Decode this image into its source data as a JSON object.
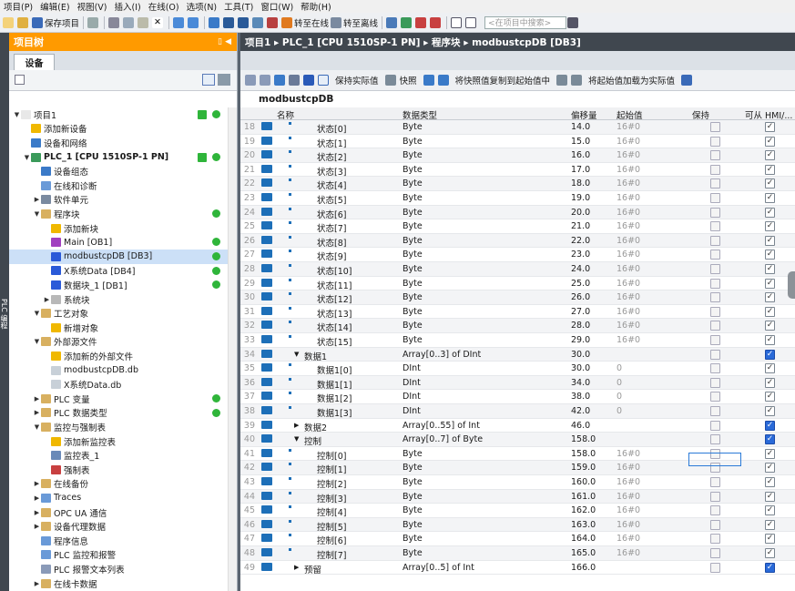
{
  "menu": [
    "项目(P)",
    "编辑(E)",
    "视图(V)",
    "插入(I)",
    "在线(O)",
    "选项(N)",
    "工具(T)",
    "窗口(W)",
    "帮助(H)"
  ],
  "toolbar": {
    "save_label": "保存项目",
    "online_label": "转至在线",
    "offline_label": "转至离线",
    "search_placeholder": "<在项目中搜索>"
  },
  "side_strip": "PLC 编程",
  "left_panel": {
    "title": "项目树",
    "tab": "设备"
  },
  "tree": [
    {
      "label": "项目1",
      "level": 0,
      "exp": "▼",
      "icon": "project-icon",
      "color": "#e8e8e8",
      "check": true,
      "dot": true
    },
    {
      "label": "添加新设备",
      "level": 1,
      "exp": "",
      "icon": "add-icon",
      "color": "#f0b800"
    },
    {
      "label": "设备和网络",
      "level": 1,
      "exp": "",
      "icon": "network-icon",
      "color": "#3a7ac8"
    },
    {
      "label": "PLC_1 [CPU 1510SP-1 PN]",
      "level": 1,
      "exp": "▼",
      "icon": "plc-icon",
      "color": "#3a9a5a",
      "check": true,
      "dot": true,
      "bold": true
    },
    {
      "label": "设备组态",
      "level": 2,
      "exp": "",
      "icon": "config-icon",
      "color": "#3a7ac8"
    },
    {
      "label": "在线和诊断",
      "level": 2,
      "exp": "",
      "icon": "diag-icon",
      "color": "#6a9ad8"
    },
    {
      "label": "软件单元",
      "level": 2,
      "exp": "▶",
      "icon": "unit-icon",
      "color": "#7a8aa0"
    },
    {
      "label": "程序块",
      "level": 2,
      "exp": "▼",
      "icon": "folder-icon",
      "color": "#d8b060",
      "dot": true
    },
    {
      "label": "添加新块",
      "level": 3,
      "exp": "",
      "icon": "add-icon",
      "color": "#f0b800"
    },
    {
      "label": "Main [OB1]",
      "level": 3,
      "exp": "",
      "icon": "ob-icon",
      "color": "#a040c0",
      "dot": true
    },
    {
      "label": "modbustcpDB [DB3]",
      "level": 3,
      "exp": "",
      "icon": "db-icon",
      "color": "#2a5ad8",
      "dot": true,
      "sel": true
    },
    {
      "label": "X系统Data [DB4]",
      "level": 3,
      "exp": "",
      "icon": "db-icon",
      "color": "#2a5ad8",
      "dot": true
    },
    {
      "label": "数据块_1 [DB1]",
      "level": 3,
      "exp": "",
      "icon": "db-icon",
      "color": "#2a5ad8",
      "dot": true
    },
    {
      "label": "系统块",
      "level": 3,
      "exp": "▶",
      "icon": "folder-icon",
      "color": "#b8b8b8"
    },
    {
      "label": "工艺对象",
      "level": 2,
      "exp": "▼",
      "icon": "folder-icon",
      "color": "#d8b060"
    },
    {
      "label": "新增对象",
      "level": 3,
      "exp": "",
      "icon": "add-icon",
      "color": "#f0b800"
    },
    {
      "label": "外部源文件",
      "level": 2,
      "exp": "▼",
      "icon": "folder-icon",
      "color": "#d8b060"
    },
    {
      "label": "添加新的外部文件",
      "level": 3,
      "exp": "",
      "icon": "add-icon",
      "color": "#f0b800"
    },
    {
      "label": "modbustcpDB.db",
      "level": 3,
      "exp": "",
      "icon": "file-icon",
      "color": "#c8d0d8"
    },
    {
      "label": "X系统Data.db",
      "level": 3,
      "exp": "",
      "icon": "file-icon",
      "color": "#c8d0d8"
    },
    {
      "label": "PLC 变量",
      "level": 2,
      "exp": "▶",
      "icon": "folder-icon",
      "color": "#d8b060",
      "dot": true
    },
    {
      "label": "PLC 数据类型",
      "level": 2,
      "exp": "▶",
      "icon": "folder-icon",
      "color": "#d8b060",
      "dot": true
    },
    {
      "label": "监控与强制表",
      "level": 2,
      "exp": "▼",
      "icon": "folder-icon",
      "color": "#d8b060"
    },
    {
      "label": "添加新监控表",
      "level": 3,
      "exp": "",
      "icon": "add-icon",
      "color": "#f0b800"
    },
    {
      "label": "监控表_1",
      "level": 3,
      "exp": "",
      "icon": "table-icon",
      "color": "#6a8ab8"
    },
    {
      "label": "强制表",
      "level": 3,
      "exp": "",
      "icon": "table-icon",
      "color": "#c84040"
    },
    {
      "label": "在线备份",
      "level": 2,
      "exp": "▶",
      "icon": "folder-icon",
      "color": "#d8b060"
    },
    {
      "label": "Traces",
      "level": 2,
      "exp": "▶",
      "icon": "folder-icon",
      "color": "#6a9ad8"
    },
    {
      "label": "OPC UA 通信",
      "level": 2,
      "exp": "▶",
      "icon": "folder-icon",
      "color": "#d8b060"
    },
    {
      "label": "设备代理数据",
      "level": 2,
      "exp": "▶",
      "icon": "folder-icon",
      "color": "#d8b060"
    },
    {
      "label": "程序信息",
      "level": 2,
      "exp": "",
      "icon": "info-icon",
      "color": "#6a9ad8"
    },
    {
      "label": "PLC 监控和报警",
      "level": 2,
      "exp": "",
      "icon": "alarm-icon",
      "color": "#6a9ad8"
    },
    {
      "label": "PLC 报警文本列表",
      "level": 2,
      "exp": "",
      "icon": "list-icon",
      "color": "#8a9ab8"
    },
    {
      "label": "在线卡数据",
      "level": 2,
      "exp": "▶",
      "icon": "folder-icon",
      "color": "#d8b060"
    }
  ],
  "breadcrumb": "项目1 ▸ PLC_1 [CPU 1510SP-1 PN] ▸ 程序块 ▸ modbustcpDB [DB3]",
  "editor_toolbar": {
    "keep_actual": "保持实际值",
    "snapshot": "快照",
    "copy_snapshot": "将快照值复制到起始值中",
    "load_start": "将起始值加载为实际值"
  },
  "db_name": "modbustcpDB",
  "columns": {
    "name": "名称",
    "type": "数据类型",
    "offset": "偏移量",
    "start": "起始值",
    "retain": "保持",
    "hmi": "可从 HMI/..."
  },
  "rows": [
    {
      "n": "18",
      "exp": "",
      "indent": 2,
      "name": "状态[0]",
      "type": "Byte",
      "offset": "14.0",
      "start": "16#0",
      "g": true,
      "s": false,
      "hmi": true
    },
    {
      "n": "19",
      "exp": "",
      "indent": 2,
      "name": "状态[1]",
      "type": "Byte",
      "offset": "15.0",
      "start": "16#0",
      "g": true,
      "s": false,
      "hmi": true
    },
    {
      "n": "20",
      "exp": "",
      "indent": 2,
      "name": "状态[2]",
      "type": "Byte",
      "offset": "16.0",
      "start": "16#0",
      "g": true,
      "s": false,
      "hmi": true
    },
    {
      "n": "21",
      "exp": "",
      "indent": 2,
      "name": "状态[3]",
      "type": "Byte",
      "offset": "17.0",
      "start": "16#0",
      "g": true,
      "s": false,
      "hmi": true
    },
    {
      "n": "22",
      "exp": "",
      "indent": 2,
      "name": "状态[4]",
      "type": "Byte",
      "offset": "18.0",
      "start": "16#0",
      "g": true,
      "s": false,
      "hmi": true
    },
    {
      "n": "23",
      "exp": "",
      "indent": 2,
      "name": "状态[5]",
      "type": "Byte",
      "offset": "19.0",
      "start": "16#0",
      "g": true,
      "s": false,
      "hmi": true
    },
    {
      "n": "24",
      "exp": "",
      "indent": 2,
      "name": "状态[6]",
      "type": "Byte",
      "offset": "20.0",
      "start": "16#0",
      "g": true,
      "s": false,
      "hmi": true
    },
    {
      "n": "25",
      "exp": "",
      "indent": 2,
      "name": "状态[7]",
      "type": "Byte",
      "offset": "21.0",
      "start": "16#0",
      "g": true,
      "s": false,
      "hmi": true
    },
    {
      "n": "26",
      "exp": "",
      "indent": 2,
      "name": "状态[8]",
      "type": "Byte",
      "offset": "22.0",
      "start": "16#0",
      "g": true,
      "s": false,
      "hmi": true
    },
    {
      "n": "27",
      "exp": "",
      "indent": 2,
      "name": "状态[9]",
      "type": "Byte",
      "offset": "23.0",
      "start": "16#0",
      "g": true,
      "s": false,
      "hmi": true
    },
    {
      "n": "28",
      "exp": "",
      "indent": 2,
      "name": "状态[10]",
      "type": "Byte",
      "offset": "24.0",
      "start": "16#0",
      "g": true,
      "s": false,
      "hmi": true
    },
    {
      "n": "29",
      "exp": "",
      "indent": 2,
      "name": "状态[11]",
      "type": "Byte",
      "offset": "25.0",
      "start": "16#0",
      "g": true,
      "s": false,
      "hmi": true
    },
    {
      "n": "30",
      "exp": "",
      "indent": 2,
      "name": "状态[12]",
      "type": "Byte",
      "offset": "26.0",
      "start": "16#0",
      "g": true,
      "s": false,
      "hmi": true
    },
    {
      "n": "31",
      "exp": "",
      "indent": 2,
      "name": "状态[13]",
      "type": "Byte",
      "offset": "27.0",
      "start": "16#0",
      "g": true,
      "s": false,
      "hmi": true
    },
    {
      "n": "32",
      "exp": "",
      "indent": 2,
      "name": "状态[14]",
      "type": "Byte",
      "offset": "28.0",
      "start": "16#0",
      "g": true,
      "s": false,
      "hmi": true
    },
    {
      "n": "33",
      "exp": "",
      "indent": 2,
      "name": "状态[15]",
      "type": "Byte",
      "offset": "29.0",
      "start": "16#0",
      "g": true,
      "s": false,
      "hmi": true
    },
    {
      "n": "34",
      "exp": "▼",
      "indent": 1,
      "name": "数据1",
      "type": "Array[0..3] of DInt",
      "offset": "30.0",
      "start": "",
      "g": false,
      "s": false,
      "hmi": true
    },
    {
      "n": "35",
      "exp": "",
      "indent": 2,
      "name": "数据1[0]",
      "type": "DInt",
      "offset": "30.0",
      "start": "0",
      "g": true,
      "s": false,
      "hmi": true
    },
    {
      "n": "36",
      "exp": "",
      "indent": 2,
      "name": "数据1[1]",
      "type": "DInt",
      "offset": "34.0",
      "start": "0",
      "g": true,
      "s": false,
      "hmi": true
    },
    {
      "n": "37",
      "exp": "",
      "indent": 2,
      "name": "数据1[2]",
      "type": "DInt",
      "offset": "38.0",
      "start": "0",
      "g": true,
      "s": false,
      "hmi": true
    },
    {
      "n": "38",
      "exp": "",
      "indent": 2,
      "name": "数据1[3]",
      "type": "DInt",
      "offset": "42.0",
      "start": "0",
      "g": true,
      "s": false,
      "hmi": true
    },
    {
      "n": "39",
      "exp": "▶",
      "indent": 1,
      "name": "数据2",
      "type": "Array[0..55] of Int",
      "offset": "46.0",
      "start": "",
      "g": false,
      "s": false,
      "hmi": true
    },
    {
      "n": "40",
      "exp": "▼",
      "indent": 1,
      "name": "控制",
      "type": "Array[0..7] of Byte",
      "offset": "158.0",
      "start": "",
      "g": false,
      "s": false,
      "hmi": true
    },
    {
      "n": "41",
      "exp": "",
      "indent": 2,
      "name": "控制[0]",
      "type": "Byte",
      "offset": "158.0",
      "start": "16#0",
      "g": true,
      "s": false,
      "hmi": true
    },
    {
      "n": "42",
      "exp": "",
      "indent": 2,
      "name": "控制[1]",
      "type": "Byte",
      "offset": "159.0",
      "start": "16#0",
      "g": true,
      "s": false,
      "hmi": true
    },
    {
      "n": "43",
      "exp": "",
      "indent": 2,
      "name": "控制[2]",
      "type": "Byte",
      "offset": "160.0",
      "start": "16#0",
      "g": true,
      "s": false,
      "hmi": true
    },
    {
      "n": "44",
      "exp": "",
      "indent": 2,
      "name": "控制[3]",
      "type": "Byte",
      "offset": "161.0",
      "start": "16#0",
      "g": true,
      "s": false,
      "hmi": true
    },
    {
      "n": "45",
      "exp": "",
      "indent": 2,
      "name": "控制[4]",
      "type": "Byte",
      "offset": "162.0",
      "start": "16#0",
      "g": true,
      "s": false,
      "hmi": true
    },
    {
      "n": "46",
      "exp": "",
      "indent": 2,
      "name": "控制[5]",
      "type": "Byte",
      "offset": "163.0",
      "start": "16#0",
      "g": true,
      "s": false,
      "hmi": true
    },
    {
      "n": "47",
      "exp": "",
      "indent": 2,
      "name": "控制[6]",
      "type": "Byte",
      "offset": "164.0",
      "start": "16#0",
      "g": true,
      "s": false,
      "hmi": true
    },
    {
      "n": "48",
      "exp": "",
      "indent": 2,
      "name": "控制[7]",
      "type": "Byte",
      "offset": "165.0",
      "start": "16#0",
      "g": true,
      "s": false,
      "hmi": true
    },
    {
      "n": "49",
      "exp": "▶",
      "indent": 1,
      "name": "预留",
      "type": "Array[0..5] of Int",
      "offset": "166.0",
      "start": "",
      "g": false,
      "s": false,
      "hmi": true
    }
  ]
}
